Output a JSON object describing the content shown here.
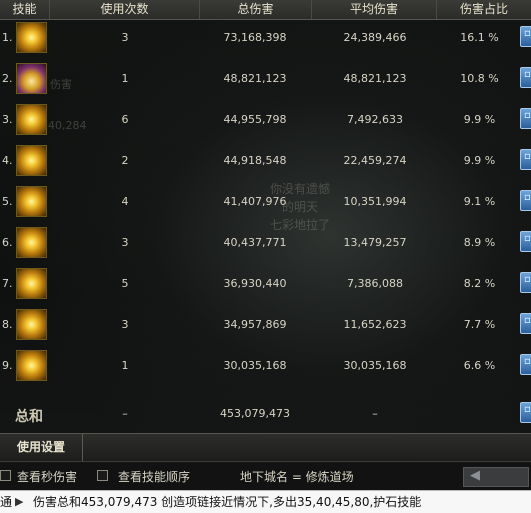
{
  "header": {
    "col_skill": "技能",
    "col_uses": "使用次数",
    "col_total": "总伤害",
    "col_avg": "平均伤害",
    "col_pct": "伤害占比"
  },
  "ghost_text": {
    "line1": "伤害",
    "line2": "40,284",
    "line3": "你没有遗憾的明天",
    "line4": "七彩地拉了"
  },
  "rows": [
    {
      "index": "1.",
      "icon": "skill-1-icon",
      "uses": "3",
      "total": "73,168,398",
      "avg": "24,389,466",
      "pct": "16.1 %"
    },
    {
      "index": "2.",
      "icon": "skill-2-icon",
      "uses": "1",
      "total": "48,821,123",
      "avg": "48,821,123",
      "pct": "10.8 %"
    },
    {
      "index": "3.",
      "icon": "skill-3-icon",
      "uses": "6",
      "total": "44,955,798",
      "avg": "7,492,633",
      "pct": "9.9 %"
    },
    {
      "index": "4.",
      "icon": "skill-4-icon",
      "uses": "2",
      "total": "44,918,548",
      "avg": "22,459,274",
      "pct": "9.9 %"
    },
    {
      "index": "5.",
      "icon": "skill-5-icon",
      "uses": "4",
      "total": "41,407,976",
      "avg": "10,351,994",
      "pct": "9.1 %"
    },
    {
      "index": "6.",
      "icon": "skill-6-icon",
      "uses": "3",
      "total": "40,437,771",
      "avg": "13,479,257",
      "pct": "8.9 %"
    },
    {
      "index": "7.",
      "icon": "skill-7-icon",
      "uses": "5",
      "total": "36,930,440",
      "avg": "7,386,088",
      "pct": "8.2 %"
    },
    {
      "index": "8.",
      "icon": "skill-8-icon",
      "uses": "3",
      "total": "34,957,869",
      "avg": "11,652,623",
      "pct": "7.7 %"
    },
    {
      "index": "9.",
      "icon": "skill-9-icon",
      "uses": "1",
      "total": "30,035,168",
      "avg": "30,035,168",
      "pct": "6.6 %"
    }
  ],
  "totals": {
    "label": "总和",
    "uses": "–",
    "total": "453,079,473",
    "avg": "–"
  },
  "settings": {
    "label": "使用设置"
  },
  "options": {
    "show_dps": "查看秒伤害",
    "show_order": "查看技能顺序",
    "dungeon": "地下城名 = 修炼道场"
  },
  "chat": {
    "tag": "通",
    "message": "伤害总和453,079,473  创造项链接近情况下,多出35,40,45,80,护石技能"
  },
  "colors": {
    "accent_gold": "#f3c531",
    "side_button": "#2c5f9a",
    "header_bg": "#2b2c29"
  }
}
